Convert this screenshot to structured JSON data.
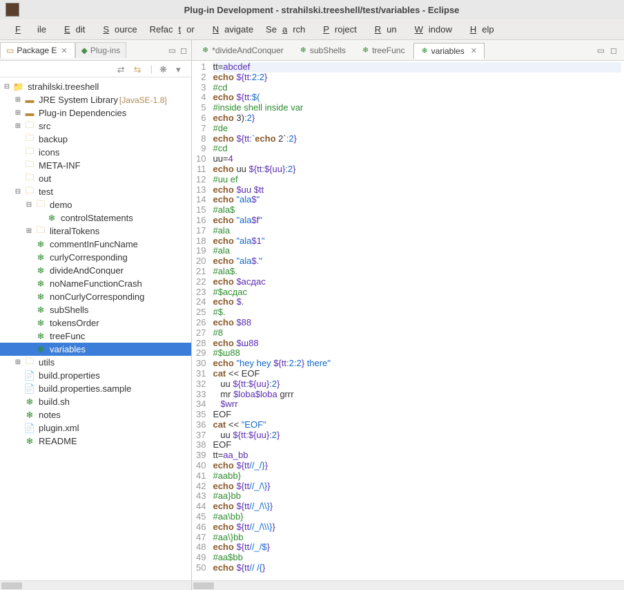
{
  "window": {
    "title": "Plug-in Development - strahilski.treeshell/test/variables - Eclipse"
  },
  "menu": {
    "file": "File",
    "edit": "Edit",
    "source": "Source",
    "refactor": "Refactor",
    "navigate": "Navigate",
    "search": "Search",
    "project": "Project",
    "run": "Run",
    "window": "Window",
    "help": "Help"
  },
  "leftTabs": {
    "package": "Package E",
    "plugins": "Plug-ins"
  },
  "tree": {
    "root": "strahilski.treeshell",
    "jre": "JRE System Library",
    "jre_ver": "[JavaSE-1.8]",
    "plugdep": "Plug-in Dependencies",
    "src": "src",
    "backup": "backup",
    "icons": "icons",
    "metainf": "META-INF",
    "out": "out",
    "test": "test",
    "demo": "demo",
    "controlStatements": "controlStatements",
    "literalTokens": "literalTokens",
    "commentInFuncName": "commentInFuncName",
    "curlyCorresponding": "curlyCorresponding",
    "divideAndConquer": "divideAndConquer",
    "noNameFunctionCrash": "noNameFunctionCrash",
    "nonCurlyCorresponding": "nonCurlyCorresponding",
    "subShells": "subShells",
    "tokensOrder": "tokensOrder",
    "treeFunc": "treeFunc",
    "variables": "variables",
    "utils": "utils",
    "buildprop": "build.properties",
    "buildpropsample": "build.properties.sample",
    "buildsh": "build.sh",
    "notes": "notes",
    "pluginxml": "plugin.xml",
    "readme": "README"
  },
  "editorTabs": {
    "t1": "*divideAndConquer",
    "t2": "subShells",
    "t3": "treeFunc",
    "t4": "variables"
  },
  "code": [
    [
      [
        "plain",
        "tt="
      ],
      [
        "var",
        "abcdef"
      ]
    ],
    [
      [
        "kw",
        "echo "
      ],
      [
        "var",
        "${tt"
      ],
      [
        "str",
        ":2:2"
      ],
      [
        "var",
        "}"
      ]
    ],
    [
      [
        "cmt",
        "#cd"
      ]
    ],
    [
      [
        "kw",
        "echo "
      ],
      [
        "var",
        "${tt"
      ],
      [
        "str",
        ":$("
      ]
    ],
    [
      [
        "cmt",
        "#inside shell inside var"
      ]
    ],
    [
      [
        "kw",
        "echo"
      ],
      [
        "plain",
        " 3)"
      ],
      [
        "str",
        ":2"
      ],
      [
        "var",
        "}"
      ]
    ],
    [
      [
        "cmt",
        "#de"
      ]
    ],
    [
      [
        "kw",
        "echo "
      ],
      [
        "var",
        "${tt"
      ],
      [
        "str",
        ":`"
      ],
      [
        "kw",
        "echo"
      ],
      [
        "plain",
        " 2`"
      ],
      [
        "str",
        ":2"
      ],
      [
        "var",
        "}"
      ]
    ],
    [
      [
        "cmt",
        "#cd"
      ]
    ],
    [
      [
        "plain",
        "uu="
      ],
      [
        "var",
        "4"
      ]
    ],
    [
      [
        "kw",
        "echo "
      ],
      [
        "plain",
        "uu "
      ],
      [
        "var",
        "${tt"
      ],
      [
        "str",
        ":"
      ],
      [
        "var",
        "${uu}"
      ],
      [
        "str",
        ":2"
      ],
      [
        "var",
        "}"
      ]
    ],
    [
      [
        "cmt",
        "#uu ef"
      ]
    ],
    [
      [
        "kw",
        "echo "
      ],
      [
        "var",
        "$uu $tt"
      ]
    ],
    [
      [
        "kw",
        "echo "
      ],
      [
        "str",
        "\"ala"
      ],
      [
        "var",
        "$"
      ],
      [
        "str",
        "\""
      ]
    ],
    [
      [
        "cmt",
        "#ala$"
      ]
    ],
    [
      [
        "kw",
        "echo "
      ],
      [
        "str",
        "\"ala"
      ],
      [
        "var",
        "$f"
      ],
      [
        "str",
        "\""
      ]
    ],
    [
      [
        "cmt",
        "#ala"
      ]
    ],
    [
      [
        "kw",
        "echo "
      ],
      [
        "str",
        "\"ala"
      ],
      [
        "var",
        "$1"
      ],
      [
        "str",
        "\""
      ]
    ],
    [
      [
        "cmt",
        "#ala"
      ]
    ],
    [
      [
        "kw",
        "echo "
      ],
      [
        "str",
        "\"ala"
      ],
      [
        "var",
        "$"
      ],
      [
        "str",
        ".\""
      ]
    ],
    [
      [
        "cmt",
        "#ala$."
      ]
    ],
    [
      [
        "kw",
        "echo "
      ],
      [
        "var",
        "$асдас"
      ]
    ],
    [
      [
        "cmt",
        "#$асдас"
      ]
    ],
    [
      [
        "kw",
        "echo "
      ],
      [
        "var",
        "$"
      ],
      [
        "plain",
        "."
      ]
    ],
    [
      [
        "cmt",
        "#$."
      ]
    ],
    [
      [
        "kw",
        "echo "
      ],
      [
        "var",
        "$88"
      ]
    ],
    [
      [
        "cmt",
        "#8"
      ]
    ],
    [
      [
        "kw",
        "echo "
      ],
      [
        "var",
        "$ш88"
      ]
    ],
    [
      [
        "cmt",
        "#$ш88"
      ]
    ],
    [
      [
        "kw",
        "echo "
      ],
      [
        "str",
        "\"hey hey "
      ],
      [
        "var",
        "${tt"
      ],
      [
        "str",
        ":2:2"
      ],
      [
        "var",
        "}"
      ],
      [
        "str",
        " there\""
      ]
    ],
    [
      [
        "kw",
        "cat "
      ],
      [
        "plain",
        "<< EOF"
      ]
    ],
    [
      [
        "plain",
        "   uu "
      ],
      [
        "var",
        "${tt"
      ],
      [
        "str",
        ":"
      ],
      [
        "var",
        "${uu}"
      ],
      [
        "str",
        ":2"
      ],
      [
        "var",
        "}"
      ]
    ],
    [
      [
        "plain",
        "   mr "
      ],
      [
        "var",
        "$loba$loba"
      ],
      [
        "plain",
        " grrr"
      ]
    ],
    [
      [
        "plain",
        "   "
      ],
      [
        "var",
        "$wrr"
      ]
    ],
    [
      [
        "plain",
        "EOF"
      ]
    ],
    [
      [
        "kw",
        "cat "
      ],
      [
        "plain",
        "<< "
      ],
      [
        "str",
        "\"EOF\""
      ]
    ],
    [
      [
        "plain",
        "   uu "
      ],
      [
        "var",
        "${tt"
      ],
      [
        "str",
        ":"
      ],
      [
        "var",
        "${uu}"
      ],
      [
        "str",
        ":2"
      ],
      [
        "var",
        "}"
      ]
    ],
    [
      [
        "plain",
        "EOF"
      ]
    ],
    [
      [
        "plain",
        "tt="
      ],
      [
        "var",
        "aa_bb"
      ]
    ],
    [
      [
        "kw",
        "echo "
      ],
      [
        "var",
        "${tt"
      ],
      [
        "str",
        "//_/}"
      ],
      [
        "var",
        "}"
      ]
    ],
    [
      [
        "cmt",
        "#aabb}"
      ]
    ],
    [
      [
        "kw",
        "echo "
      ],
      [
        "var",
        "${tt"
      ],
      [
        "str",
        "//_/\\}"
      ],
      [
        "var",
        "}"
      ]
    ],
    [
      [
        "cmt",
        "#aa}bb"
      ]
    ],
    [
      [
        "kw",
        "echo "
      ],
      [
        "var",
        "${tt"
      ],
      [
        "str",
        "//_/\\\\}"
      ],
      [
        "var",
        "}"
      ]
    ],
    [
      [
        "cmt",
        "#aa\\bb}"
      ]
    ],
    [
      [
        "kw",
        "echo "
      ],
      [
        "var",
        "${tt"
      ],
      [
        "str",
        "//_/\\\\\\}"
      ],
      [
        "var",
        "}"
      ]
    ],
    [
      [
        "cmt",
        "#aa\\}bb"
      ]
    ],
    [
      [
        "kw",
        "echo "
      ],
      [
        "var",
        "${tt"
      ],
      [
        "str",
        "//_/$"
      ],
      [
        "var",
        "}"
      ]
    ],
    [
      [
        "cmt",
        "#aa$bb"
      ]
    ],
    [
      [
        "kw",
        "echo "
      ],
      [
        "var",
        "${tt"
      ],
      [
        "str",
        "// /{"
      ],
      [
        "var",
        "}"
      ]
    ]
  ]
}
